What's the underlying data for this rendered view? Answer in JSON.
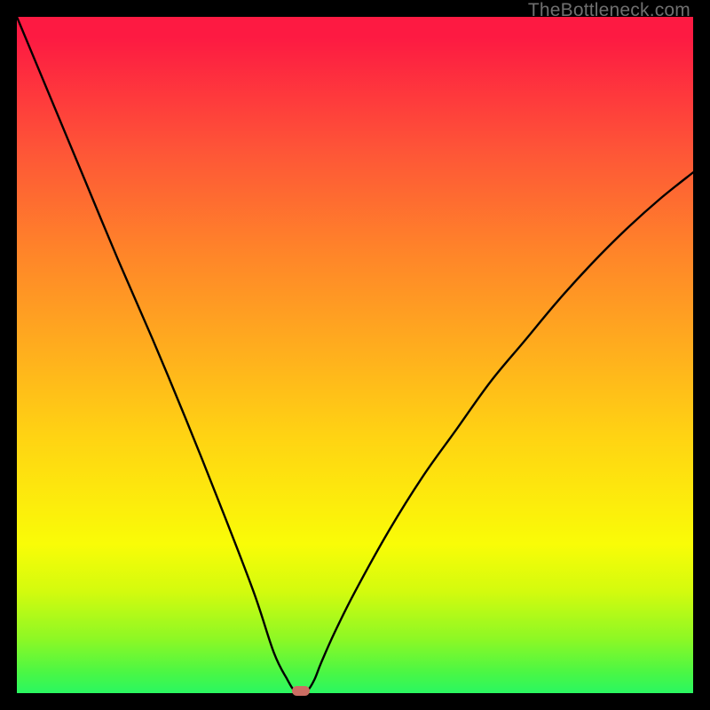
{
  "watermark": {
    "text": "TheBottleneck.com"
  },
  "chart_data": {
    "type": "line",
    "title": "",
    "xlabel": "",
    "ylabel": "",
    "xlim": [
      0,
      100
    ],
    "ylim": [
      0,
      100
    ],
    "series": [
      {
        "name": "bottleneck-curve",
        "x": [
          0,
          5,
          10,
          15,
          20,
          25,
          30,
          35,
          38,
          40,
          41,
          42,
          43,
          44,
          45,
          47,
          50,
          55,
          60,
          65,
          70,
          75,
          80,
          85,
          90,
          95,
          100
        ],
        "values": [
          100,
          88,
          76,
          64,
          52.5,
          40.5,
          28,
          15,
          6,
          2,
          0.4,
          0,
          0.4,
          2,
          4.5,
          9,
          15,
          24,
          32,
          39,
          46,
          52,
          58,
          63.5,
          68.5,
          73,
          77
        ]
      }
    ],
    "marker": {
      "x_pct": 42,
      "y_pct": 0,
      "color": "#cc6d63"
    },
    "background_gradient": {
      "stops": [
        {
          "pct": 0,
          "color": "#fd1a42"
        },
        {
          "pct": 20,
          "color": "#fe5637"
        },
        {
          "pct": 35,
          "color": "#ff8529"
        },
        {
          "pct": 50,
          "color": "#ffb01d"
        },
        {
          "pct": 62,
          "color": "#ffd313"
        },
        {
          "pct": 73,
          "color": "#fcef0b"
        },
        {
          "pct": 85,
          "color": "#d3fb0e"
        },
        {
          "pct": 97,
          "color": "#4af745"
        },
        {
          "pct": 100,
          "color": "#2af761"
        }
      ]
    }
  }
}
